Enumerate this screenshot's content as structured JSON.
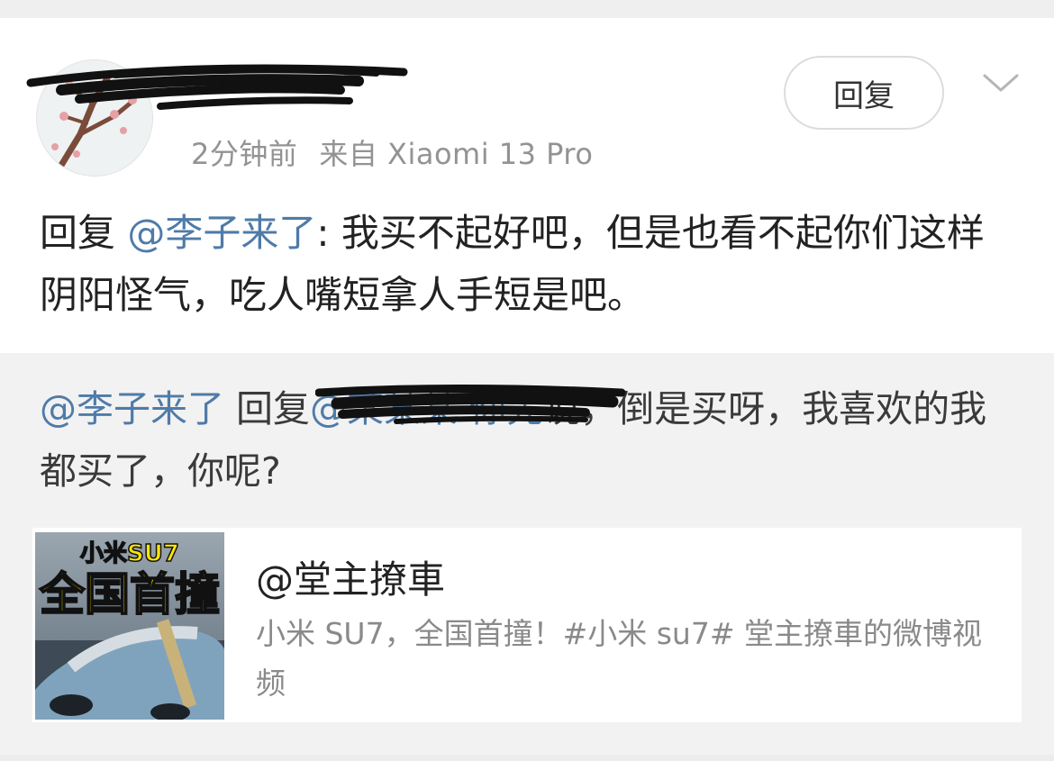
{
  "post": {
    "username": "",
    "meta_time": "2分钟前",
    "meta_source": "来自 Xiaomi 13 Pro",
    "reply_button": "回复",
    "more_icon": "chevron-down-icon"
  },
  "comment": {
    "prefix": "回复 ",
    "mention": "@李子来了",
    "text": ": 我买不起好吧，但是也看不起你们这样阴阳怪气，吃人嘴短拿人手短是吧。"
  },
  "quoted": {
    "mention": "@李子来了",
    "reply_word": " 回复",
    "hidden_text": "@某某某 你先",
    "text": "说，倒是买呀，我喜欢的我都买了，你呢?"
  },
  "link_card": {
    "thumb_line1": "小米SU7",
    "thumb_line2": "全国首撞",
    "title": "@堂主撩車",
    "description": "小米 SU7，全国首撞！#小米 su7# 堂主撩車的微博视频"
  },
  "colors": {
    "mention": "#4f7ba8",
    "thumb_text": "#ffe600",
    "background": "#f2f2f2"
  }
}
